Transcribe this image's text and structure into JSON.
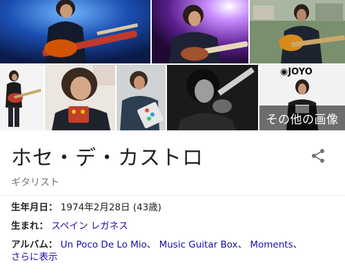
{
  "images": {
    "more_label": "その他の画像",
    "logo_text": "JOYO"
  },
  "entity": {
    "title": "ホセ・デ・カストロ",
    "subtitle": "ギタリスト"
  },
  "facts": {
    "born": {
      "label": "生年月日：",
      "value": "1974年2月28日 (43歳)"
    },
    "birthplace": {
      "label": "生まれ：",
      "value": "スペイン レガネス"
    },
    "albums": {
      "label": "アルバム：",
      "items": [
        "Un Poco De Lo Mio",
        "Music Guitar Box",
        "Moments"
      ],
      "separator": "、",
      "more": "さらに表示"
    }
  },
  "colors": {
    "link": "#1a0dab",
    "text": "#202124",
    "secondary": "#70757a"
  }
}
